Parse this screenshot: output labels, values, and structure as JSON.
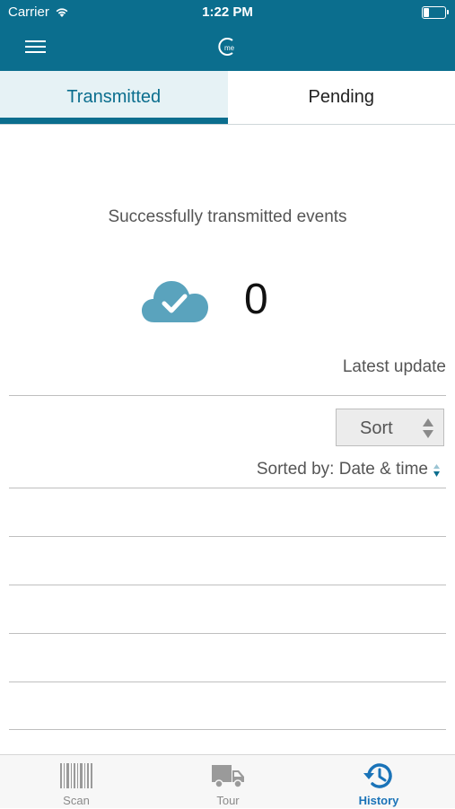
{
  "status_bar": {
    "carrier": "Carrier",
    "time": "1:22 PM"
  },
  "header": {
    "menu_icon": "hamburger-menu-icon",
    "logo_icon": "app-logo-icon"
  },
  "tabs": [
    {
      "label": "Transmitted",
      "active": true
    },
    {
      "label": "Pending",
      "active": false
    }
  ],
  "summary": {
    "title": "Successfully transmitted events",
    "count": "0",
    "icon": "cloud-check-icon",
    "latest_update_label": "Latest update"
  },
  "sort": {
    "button_label": "Sort",
    "sorted_by": "Sorted by: Date & time"
  },
  "bottom_nav": [
    {
      "label": "Scan",
      "icon": "barcode-icon",
      "active": false
    },
    {
      "label": "Tour",
      "icon": "truck-icon",
      "active": false
    },
    {
      "label": "History",
      "icon": "history-icon",
      "active": true
    }
  ],
  "colors": {
    "brand": "#0b6e8e",
    "cloud": "#5aa3bd",
    "active_nav": "#1a73b8"
  }
}
